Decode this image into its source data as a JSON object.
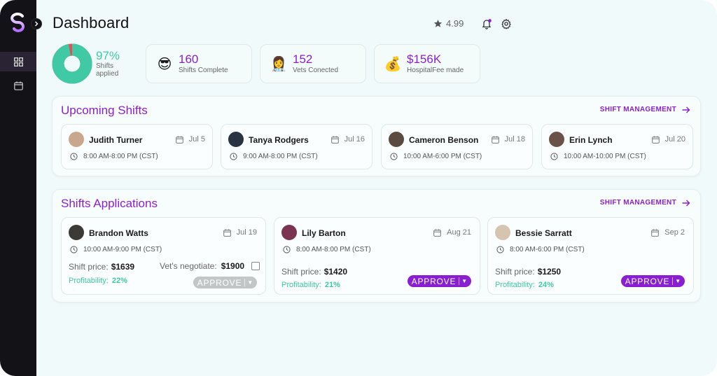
{
  "header": {
    "title": "Dashboard",
    "rating": "4.99"
  },
  "sidebar": {
    "items": [
      {
        "name": "dashboard"
      },
      {
        "name": "calendar"
      }
    ]
  },
  "stats": {
    "applied": {
      "percent": "97%",
      "label": "Shifts applied",
      "fraction": 0.97
    },
    "cards": [
      {
        "emoji": "😎",
        "value": "160",
        "label": "Shifts Complete"
      },
      {
        "emoji": "👩‍⚕️",
        "value": "152",
        "label": "Vets Conected"
      },
      {
        "emoji": "💰",
        "value": "$156K",
        "label": "HospitalFee made"
      }
    ]
  },
  "upcoming": {
    "title": "Upcoming Shifts",
    "link": "SHIFT MANAGEMENT",
    "shifts": [
      {
        "name": "Judith Turner",
        "date": "Jul 5",
        "time": "8:00 AM-8:00 PM (CST)"
      },
      {
        "name": "Tanya Rodgers",
        "date": "Jul 16",
        "time": "9:00 AM-8:00 PM (CST)"
      },
      {
        "name": "Cameron Benson",
        "date": "Jul 18",
        "time": "10:00 AM-6:00 PM (CST)"
      },
      {
        "name": "Erin Lynch",
        "date": "Jul 20",
        "time": "10:00 AM-10:00 PM (CST)"
      }
    ]
  },
  "applications": {
    "title": "Shifts Applications",
    "link": "SHIFT MANAGEMENT",
    "items": [
      {
        "name": "Brandon Watts",
        "date": "Jul 19",
        "time": "10:00 AM-9:00 PM (CST)",
        "price_label": "Shift price:",
        "price": "$1639",
        "negotiate_label": "Vet's negotiate:",
        "negotiate": "$1900",
        "profit_label": "Profitability:",
        "profit": "22%",
        "approve": "APPROVE"
      },
      {
        "name": "Lily Barton",
        "date": "Aug 21",
        "time": "8:00 AM-8:00 PM (CST)",
        "price_label": "Shift price:",
        "price": "$1420",
        "profit_label": "Profitability:",
        "profit": "21%",
        "approve": "APPROVE"
      },
      {
        "name": "Bessie Sarratt",
        "date": "Sep 2",
        "time": "8:00 AM-6:00 PM (CST)",
        "price_label": "Shift price:",
        "price": "$1250",
        "profit_label": "Profitability:",
        "profit": "24%",
        "approve": "APPROVE"
      }
    ]
  },
  "colors": {
    "accent": "#8a1fd1",
    "green": "#3fc9a5",
    "red": "#e4505a",
    "sidebar": "#131217"
  }
}
